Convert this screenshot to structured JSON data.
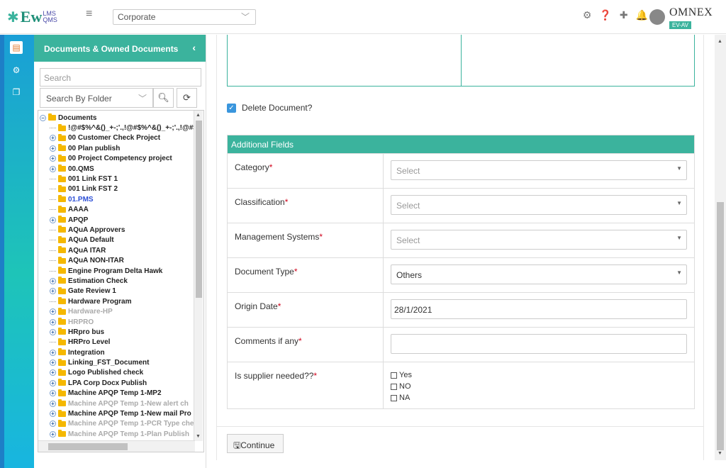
{
  "app": {
    "logo_main": "Ew",
    "logo_top": "LMS",
    "logo_bottom": "QMS",
    "corporate_select": "Corporate",
    "company_name": "OMNEX",
    "company_badge": "EV-AV"
  },
  "sidebar": {
    "title": "Documents & Owned Documents",
    "search_placeholder": "Search",
    "folder_select": "Search By Folder",
    "root": "Documents",
    "nodes": [
      {
        "label": "!@#$%^&()_+-;'.,!@#$%^&()_+-;'.,!@#$",
        "expander": false,
        "style": "normal"
      },
      {
        "label": "00 Customer Check Project",
        "expander": true,
        "style": "normal"
      },
      {
        "label": "00 Plan publish",
        "expander": true,
        "style": "normal"
      },
      {
        "label": "00 Project Competency project",
        "expander": true,
        "style": "normal"
      },
      {
        "label": "00.QMS",
        "expander": true,
        "style": "normal"
      },
      {
        "label": "001 Link FST 1",
        "expander": false,
        "style": "normal"
      },
      {
        "label": "001 Link FST 2",
        "expander": false,
        "style": "normal"
      },
      {
        "label": "01.PMS",
        "expander": false,
        "style": "blue"
      },
      {
        "label": "AAAA",
        "expander": false,
        "style": "normal"
      },
      {
        "label": "APQP",
        "expander": true,
        "style": "normal"
      },
      {
        "label": "AQuA Approvers",
        "expander": false,
        "style": "normal"
      },
      {
        "label": "AQuA Default",
        "expander": false,
        "style": "normal"
      },
      {
        "label": "AQuA ITAR",
        "expander": false,
        "style": "normal"
      },
      {
        "label": "AQuA NON-ITAR",
        "expander": false,
        "style": "normal"
      },
      {
        "label": "Engine Program Delta Hawk",
        "expander": false,
        "style": "normal"
      },
      {
        "label": "Estimation Check",
        "expander": true,
        "style": "normal"
      },
      {
        "label": "Gate Review 1",
        "expander": true,
        "style": "normal"
      },
      {
        "label": "Hardware Program",
        "expander": false,
        "style": "normal"
      },
      {
        "label": "Hardware-HP",
        "expander": true,
        "style": "grey"
      },
      {
        "label": "HRPRO",
        "expander": true,
        "style": "grey"
      },
      {
        "label": "HRpro bus",
        "expander": true,
        "style": "normal"
      },
      {
        "label": "HRPro Level",
        "expander": false,
        "style": "normal"
      },
      {
        "label": "Integration",
        "expander": true,
        "style": "normal"
      },
      {
        "label": "Linking_FST_Document",
        "expander": true,
        "style": "normal"
      },
      {
        "label": "Logo Published check",
        "expander": true,
        "style": "normal"
      },
      {
        "label": "LPA Corp Docx Publish",
        "expander": true,
        "style": "normal"
      },
      {
        "label": "Machine APQP Temp 1-MP2",
        "expander": true,
        "style": "normal"
      },
      {
        "label": "Machine APQP Temp 1-New alert ch",
        "expander": true,
        "style": "grey"
      },
      {
        "label": "Machine APQP Temp 1-New mail Pro",
        "expander": true,
        "style": "normal"
      },
      {
        "label": "Machine APQP Temp 1-PCR Type che",
        "expander": true,
        "style": "grey"
      },
      {
        "label": "Machine APQP Temp 1-Plan Publish",
        "expander": true,
        "style": "grey"
      }
    ]
  },
  "main": {
    "delete_label": "Delete Document?",
    "additional_title": "Additional Fields",
    "fields": [
      {
        "label": "Category",
        "type": "select",
        "value": "Select",
        "filled": false
      },
      {
        "label": "Classification",
        "type": "select",
        "value": "Select",
        "filled": false
      },
      {
        "label": "Management Systems",
        "type": "select",
        "value": "Select",
        "filled": false
      },
      {
        "label": "Document Type",
        "type": "select",
        "value": "Others",
        "filled": true
      },
      {
        "label": "Origin Date",
        "type": "input",
        "value": "28/1/2021"
      },
      {
        "label": "Comments if any",
        "type": "input",
        "value": ""
      }
    ],
    "supplier": {
      "label": "Is supplier needed??",
      "options": [
        "Yes",
        "NO",
        "NA"
      ]
    },
    "continue_label": "Continue"
  },
  "colors": {
    "teal": "#3bb39d",
    "rail_gradient_top": "#1a9fd6",
    "checkbox_blue": "#3a96dd",
    "required_red": "#d0021b"
  }
}
